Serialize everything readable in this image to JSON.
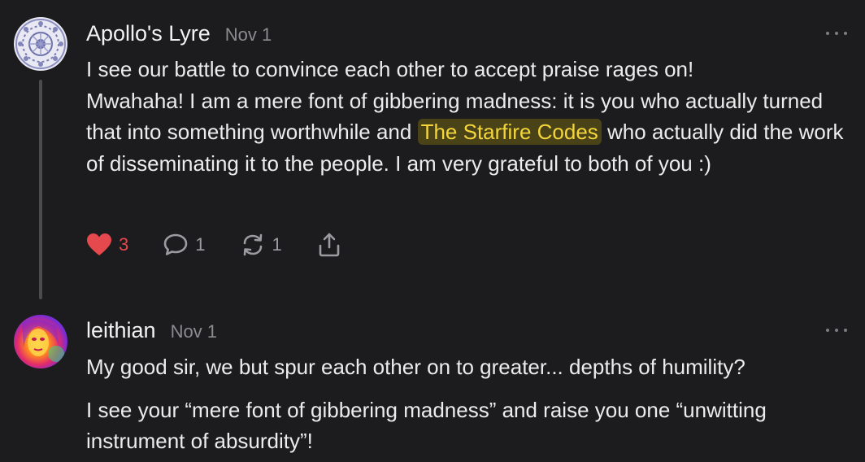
{
  "comments": [
    {
      "author": "Apollo's Lyre",
      "date": "Nov 1",
      "avatar_icon": "mandala-pattern-avatar",
      "body_line1": "I see our battle to convince each other to accept praise rages on!",
      "body_part_a": "Mwahaha! I am a mere font of gibbering madness: it is you who actually turned that into something worthwhile and ",
      "mention": "The Starfire Codes",
      "body_part_b": " who actually did the work of disseminating it to the people. I am very grateful to both of you :)",
      "actions": {
        "likes": "3",
        "replies": "1",
        "restacks": "1"
      },
      "liked": true
    },
    {
      "author": "leithian",
      "date": "Nov 1",
      "avatar_icon": "thermal-portrait-avatar",
      "paragraph1": "My good sir, we but spur each other on to greater... depths of humility?",
      "paragraph2": "I see your “mere font of gibbering madness” and raise you one “unwitting instrument of absurdity”!"
    }
  ],
  "colors": {
    "background": "#1c1c1e",
    "mention_text": "#f4d63b",
    "mention_bg": "#4a4318",
    "like_red": "#e5484d",
    "muted": "#8c8c90"
  }
}
